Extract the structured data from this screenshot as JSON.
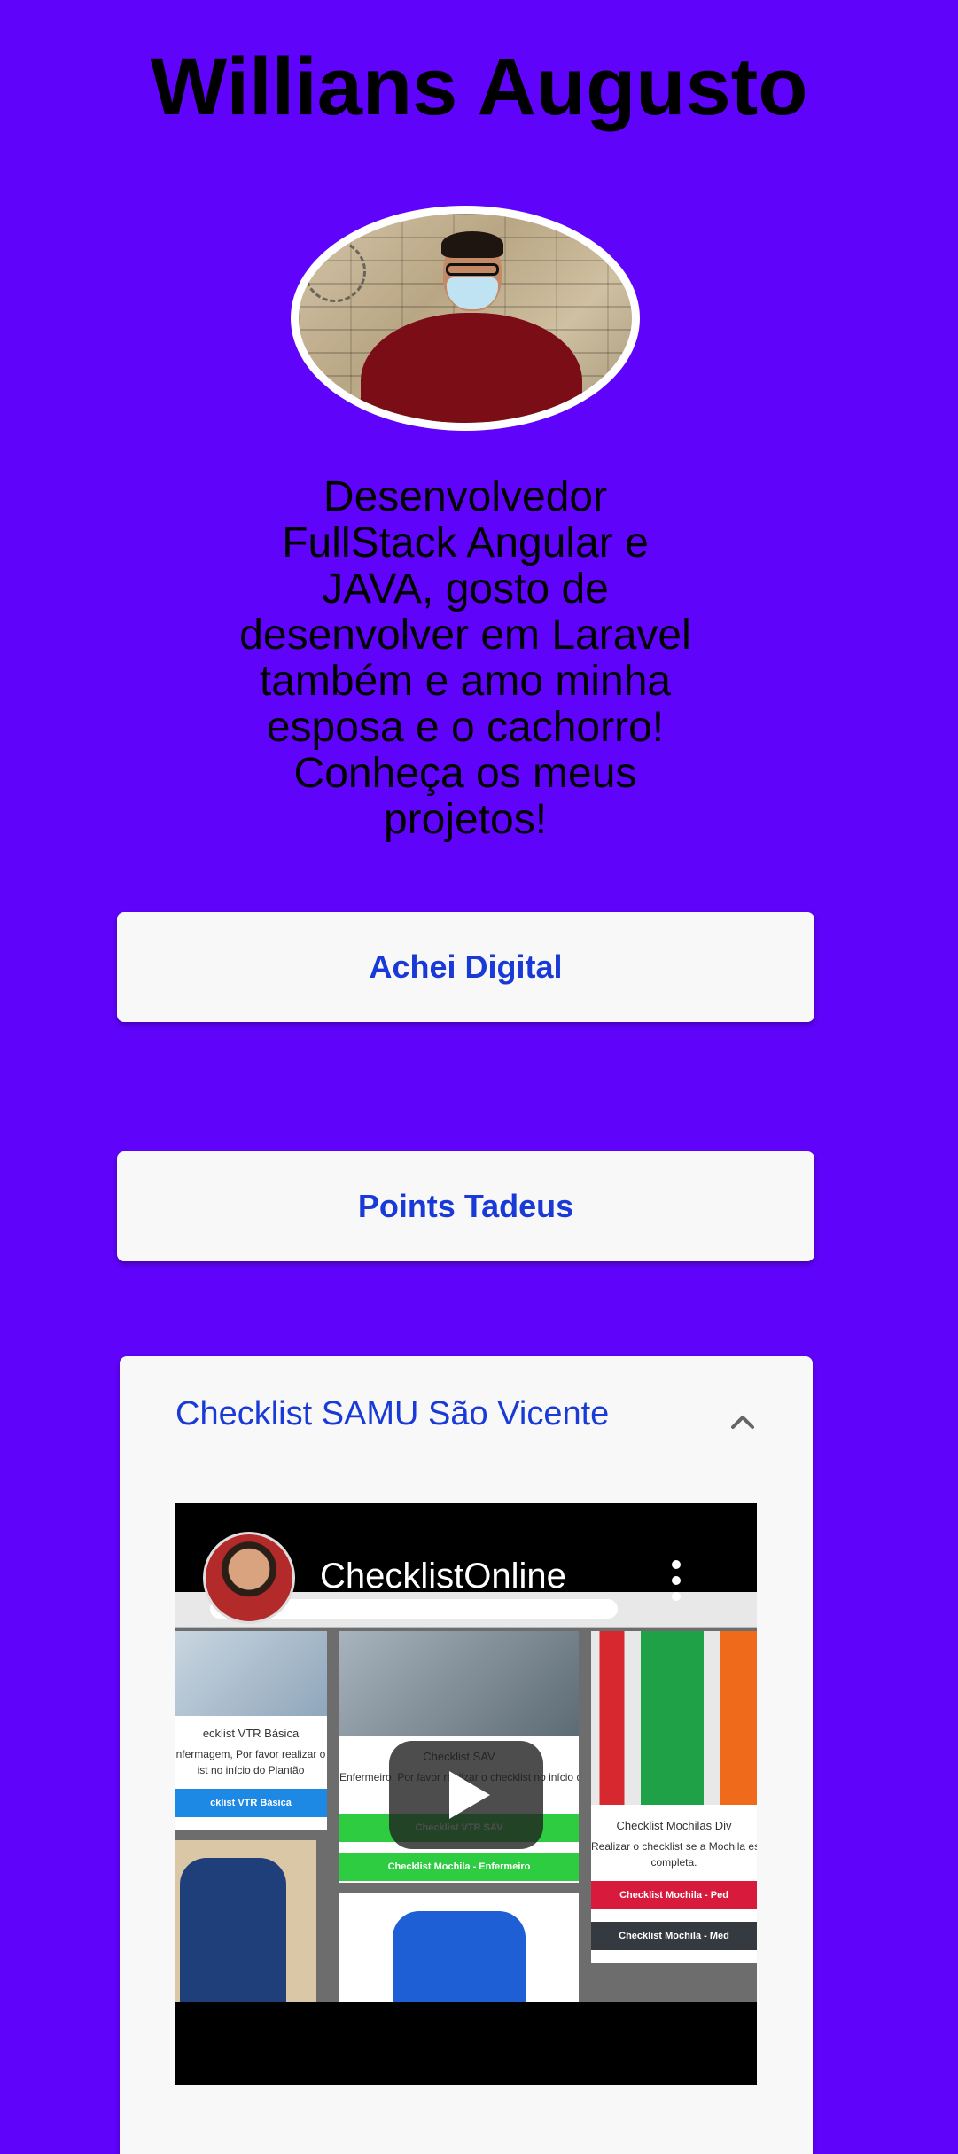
{
  "profile": {
    "name": "Willians Augusto",
    "bio": "Desenvolvedor FullStack Angular e JAVA, gosto de desenvolver em Laravel também e amo minha esposa e o cachorro! Conheça os meus projetos!"
  },
  "links": [
    {
      "label": "Achei Digital"
    },
    {
      "label": "Points Tadeus"
    }
  ],
  "panel": {
    "title": "Checklist SAMU São Vicente",
    "expanded": true,
    "chevron_icon": "chevron-up-icon",
    "video": {
      "channel_name": "ChecklistOnline",
      "play_icon": "play-icon",
      "menu_icon": "more-vertical-icon",
      "thumbnail_cards": [
        {
          "title": "ecklist VTR Básica",
          "text": "nfermagem, Por favor realizar o",
          "text2": "ist no início do Plantão",
          "button": "cklist VTR Básica",
          "button_color": "#1e88e5"
        },
        {
          "title": "Checklist SAV",
          "text": "Enfermeiro, Por favor realizar o checklist no início do",
          "button": "Checklist VTR SAV",
          "button_color": "#2ecc40",
          "button2": "Checklist Mochila - Enfermeiro",
          "button2_color": "#2ecc40"
        },
        {
          "title": "Checklist Mochilas Div",
          "text": "Realizar o checklist se a Mochila está",
          "text2": "completa.",
          "button": "Checklist Mochila - Ped",
          "button_color": "#d81b3c",
          "button2": "Checklist Mochila - Med",
          "button2_color": "#343a40"
        }
      ]
    }
  },
  "colors": {
    "background": "#6003fb",
    "link_text": "#1a3ad7",
    "button_bg": "#f8f8f8"
  }
}
